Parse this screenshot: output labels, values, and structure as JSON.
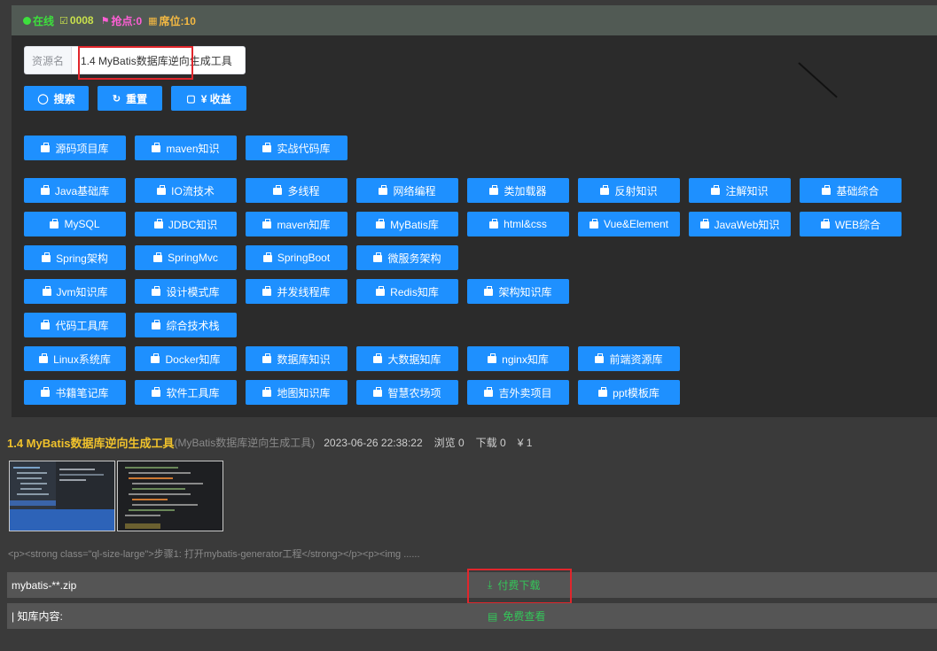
{
  "status": {
    "online": "在线",
    "count": "0008",
    "grab": "抢点:0",
    "seat": "席位:10"
  },
  "search": {
    "label": "资源名",
    "value": "1.4 MyBatis数据库逆向生成工具"
  },
  "actions": {
    "search": "搜索",
    "reset": "重置",
    "income": "¥ 收益"
  },
  "categories": [
    "源码项目库",
    "maven知识",
    "实战代码库",
    "Java基础库",
    "IO流技术",
    "多线程",
    "网络编程",
    "类加载器",
    "反射知识",
    "注解知识",
    "基础综合",
    "MySQL",
    "JDBC知识",
    "maven知库",
    "MyBatis库",
    "html&css",
    "Vue&Element",
    "JavaWeb知识",
    "WEB综合",
    "Spring架构",
    "SpringMvc",
    "SpringBoot",
    "微服务架构",
    "Jvm知识库",
    "设计模式库",
    "并发线程库",
    "Redis知库",
    "架构知识库",
    "代码工具库",
    "综合技术栈",
    "Linux系统库",
    "Docker知库",
    "数据库知识",
    "大数据知库",
    "nginx知库",
    "前端资源库",
    "书籍笔记库",
    "软件工具库",
    "地图知识库",
    "智慧农场项",
    "吉外卖项目",
    "ppt模板库"
  ],
  "resource": {
    "title": "1.4 MyBatis数据库逆向生成工具",
    "subtitle": "(MyBatis数据库逆向生成工具)",
    "datetime": "2023-06-26 22:38:22",
    "views": "浏览 0",
    "downloads": "下载 0",
    "price": "¥ 1",
    "excerpt": "<p><strong class=\"ql-size-large\">步骤1: 打开mybatis-generator工程</strong></p><p><img ......"
  },
  "file_row": {
    "name": "mybatis-**.zip",
    "action": "付费下载"
  },
  "content_row": {
    "name": "| 知库内容:",
    "action": "免费查看"
  },
  "colors": {
    "accent": "#1e90ff",
    "title": "#f0c22c",
    "link": "#34c759",
    "highlight": "#e0262c"
  }
}
